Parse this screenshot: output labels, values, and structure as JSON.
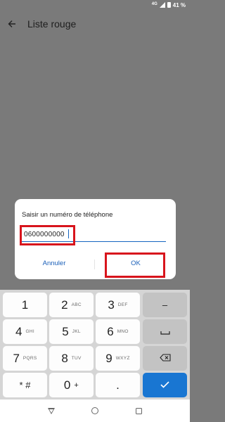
{
  "status_bar": {
    "network": "4G",
    "battery_text": "41 %"
  },
  "app_bar": {
    "title": "Liste rouge"
  },
  "dialog": {
    "title": "Saisir un numéro de téléphone",
    "input_value": "0600000000",
    "cancel_label": "Annuler",
    "ok_label": "OK"
  },
  "keypad": {
    "keys": [
      {
        "num": "1",
        "letters": ""
      },
      {
        "num": "2",
        "letters": "ABC"
      },
      {
        "num": "3",
        "letters": "DEF"
      },
      {
        "num": "4",
        "letters": "GHI"
      },
      {
        "num": "5",
        "letters": "JKL"
      },
      {
        "num": "6",
        "letters": "MNO"
      },
      {
        "num": "7",
        "letters": "PQRS"
      },
      {
        "num": "8",
        "letters": "TUV"
      },
      {
        "num": "9",
        "letters": "WXYZ"
      },
      {
        "num": "* #",
        "letters": ""
      },
      {
        "num": "0",
        "letters": "+"
      },
      {
        "num": ".",
        "letters": ""
      }
    ],
    "minus_label": "–"
  },
  "colors": {
    "accent": "#1976d2",
    "highlight": "#d8141c",
    "scrim": "#7a7a7a"
  }
}
